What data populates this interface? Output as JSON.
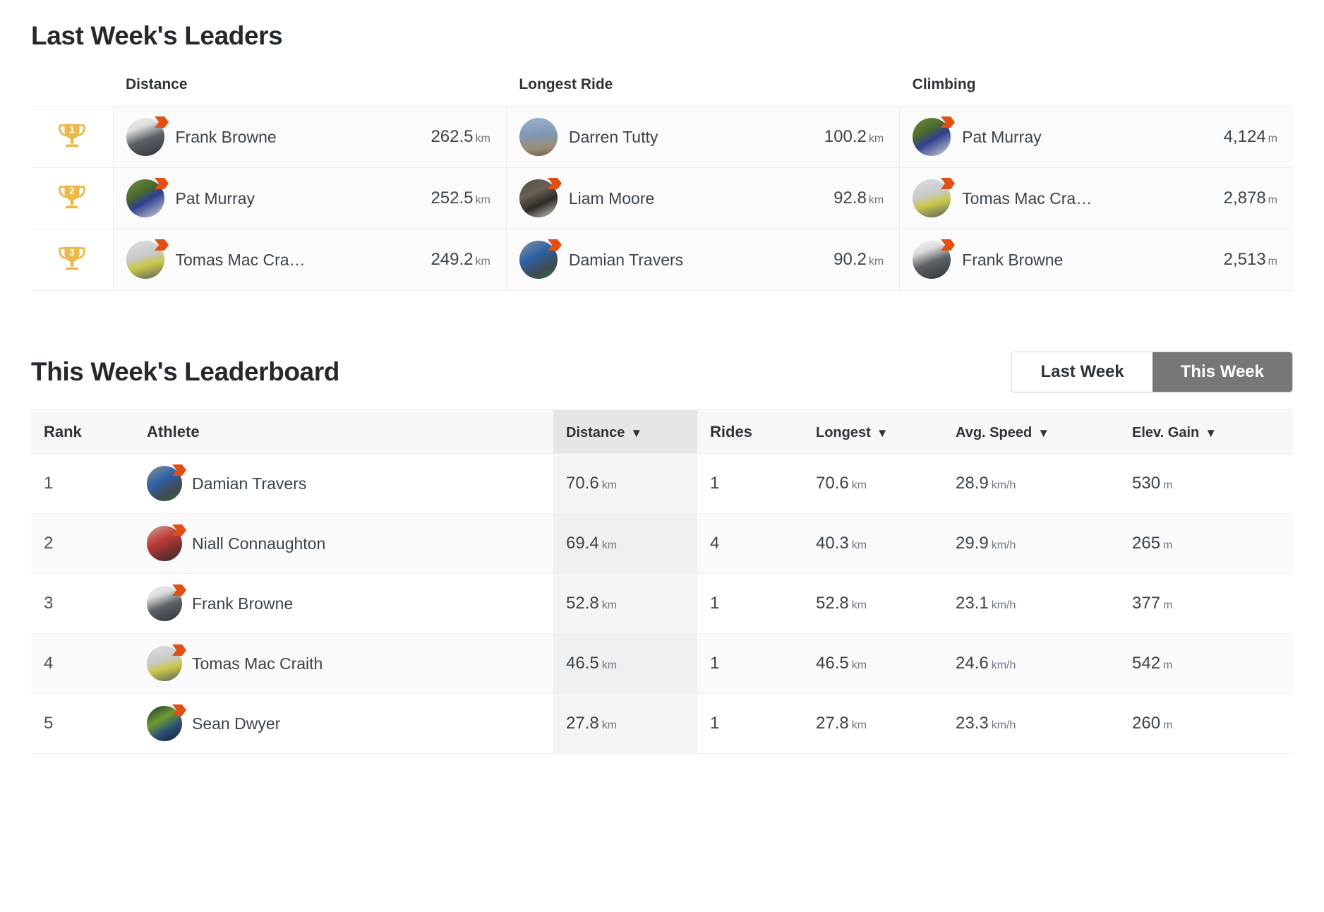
{
  "leaders": {
    "title": "Last Week's Leaders",
    "columns": [
      {
        "key": "distance",
        "label": "Distance"
      },
      {
        "key": "longest",
        "label": "Longest Ride"
      },
      {
        "key": "climbing",
        "label": "Climbing"
      }
    ],
    "rows": [
      {
        "rank": "1",
        "trophy_icon": "trophy-icon",
        "distance": {
          "name": "Frank Browne",
          "value": "262.5",
          "unit": "km",
          "avatar": "frank-browne-avatar",
          "badge": true
        },
        "longest": {
          "name": "Darren Tutty",
          "value": "100.2",
          "unit": "km",
          "avatar": "darren-tutty-avatar",
          "badge": false
        },
        "climbing": {
          "name": "Pat Murray",
          "value": "4,124",
          "unit": "m",
          "avatar": "pat-murray-avatar",
          "badge": true
        }
      },
      {
        "rank": "2",
        "trophy_icon": "trophy-icon",
        "distance": {
          "name": "Pat Murray",
          "value": "252.5",
          "unit": "km",
          "avatar": "pat-murray-avatar",
          "badge": true
        },
        "longest": {
          "name": "Liam Moore",
          "value": "92.8",
          "unit": "km",
          "avatar": "liam-moore-avatar",
          "badge": true
        },
        "climbing": {
          "name": "Tomas Mac Cra…",
          "value": "2,878",
          "unit": "m",
          "avatar": "tomas-mac-craith-avatar",
          "badge": true
        }
      },
      {
        "rank": "3",
        "trophy_icon": "trophy-icon",
        "distance": {
          "name": "Tomas Mac Cra…",
          "value": "249.2",
          "unit": "km",
          "avatar": "tomas-mac-craith-avatar",
          "badge": true
        },
        "longest": {
          "name": "Damian Travers",
          "value": "90.2",
          "unit": "km",
          "avatar": "damian-travers-avatar",
          "badge": true
        },
        "climbing": {
          "name": "Frank Browne",
          "value": "2,513",
          "unit": "m",
          "avatar": "frank-browne-avatar",
          "badge": true
        }
      }
    ]
  },
  "leaderboard": {
    "title": "This Week's Leaderboard",
    "toggle": {
      "last_week_label": "Last Week",
      "this_week_label": "This Week",
      "active": "This Week"
    },
    "headers": {
      "rank": "Rank",
      "athlete": "Athlete",
      "distance": "Distance",
      "rides": "Rides",
      "longest": "Longest",
      "avg_speed": "Avg. Speed",
      "elev_gain": "Elev. Gain",
      "caret": "▼"
    },
    "sorted_column": "distance",
    "rows": [
      {
        "rank": "1",
        "name": "Damian Travers",
        "avatar": "damian-travers-avatar",
        "distance": "70.6",
        "distance_unit": "km",
        "rides": "1",
        "longest": "70.6",
        "longest_unit": "km",
        "avg_speed": "28.9",
        "avg_speed_unit": "km/h",
        "elev_gain": "530",
        "elev_unit": "m"
      },
      {
        "rank": "2",
        "name": "Niall Connaughton",
        "avatar": "niall-connaughton-avatar",
        "distance": "69.4",
        "distance_unit": "km",
        "rides": "4",
        "longest": "40.3",
        "longest_unit": "km",
        "avg_speed": "29.9",
        "avg_speed_unit": "km/h",
        "elev_gain": "265",
        "elev_unit": "m"
      },
      {
        "rank": "3",
        "name": "Frank Browne",
        "avatar": "frank-browne-avatar",
        "distance": "52.8",
        "distance_unit": "km",
        "rides": "1",
        "longest": "52.8",
        "longest_unit": "km",
        "avg_speed": "23.1",
        "avg_speed_unit": "km/h",
        "elev_gain": "377",
        "elev_unit": "m"
      },
      {
        "rank": "4",
        "name": "Tomas Mac Craith",
        "avatar": "tomas-mac-craith-avatar",
        "distance": "46.5",
        "distance_unit": "km",
        "rides": "1",
        "longest": "46.5",
        "longest_unit": "km",
        "avg_speed": "24.6",
        "avg_speed_unit": "km/h",
        "elev_gain": "542",
        "elev_unit": "m"
      },
      {
        "rank": "5",
        "name": "Sean Dwyer",
        "avatar": "sean-dwyer-avatar",
        "distance": "27.8",
        "distance_unit": "km",
        "rides": "1",
        "longest": "27.8",
        "longest_unit": "km",
        "avg_speed": "23.3",
        "avg_speed_unit": "km/h",
        "elev_gain": "260",
        "elev_unit": "m"
      }
    ]
  },
  "colors": {
    "trophy_gold": "#e9b949",
    "badge_orange": "#e04f15",
    "active_toggle_bg": "#777777",
    "sorted_column_bg": "#e6e6e6",
    "text": "#3b444c"
  }
}
